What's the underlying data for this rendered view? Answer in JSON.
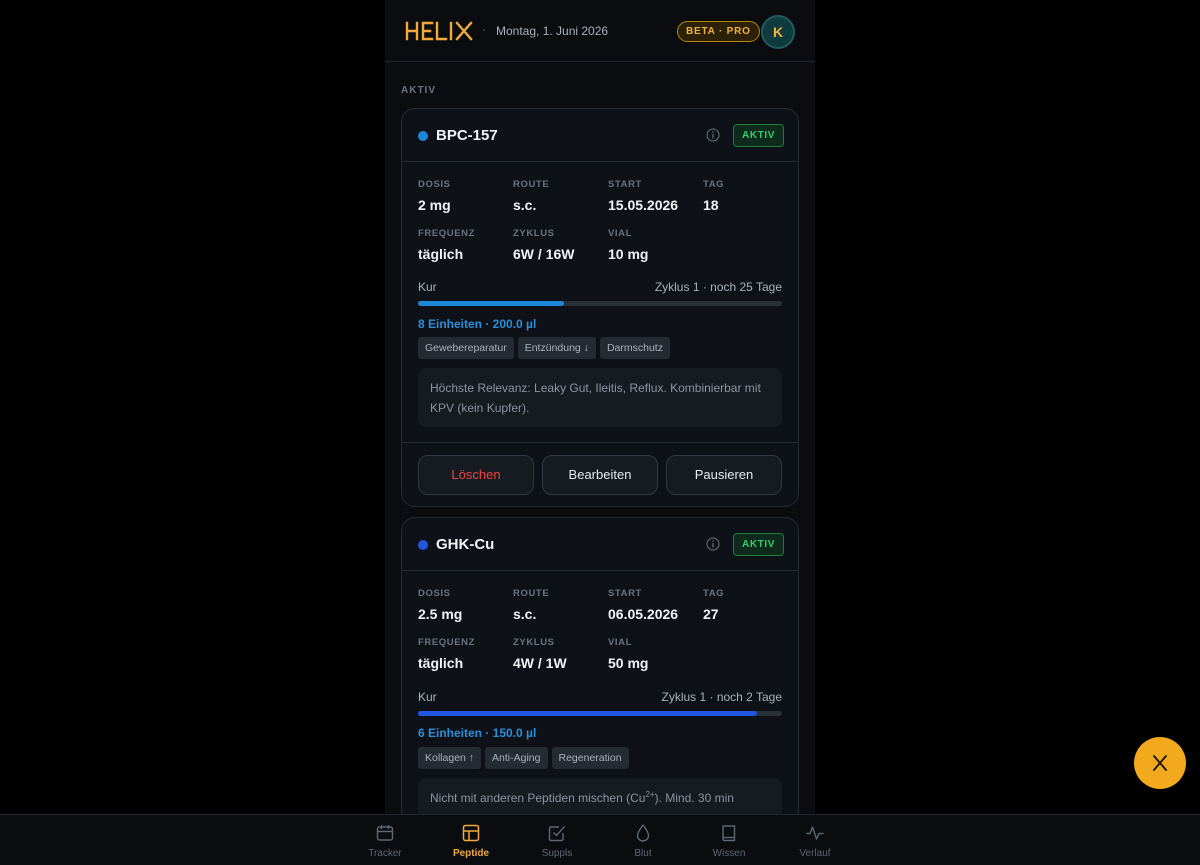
{
  "header": {
    "logo_text": "HELIX",
    "separator": "·",
    "date": "Montag, 1. Juni 2026",
    "badge": "BETA · PRO",
    "avatar_initial": "K"
  },
  "section_label": "AKTIV",
  "field_labels": {
    "dose": "DOSIS",
    "route": "ROUTE",
    "start": "START",
    "day": "TAG",
    "frequency": "FREQUENZ",
    "cycle": "ZYKLUS",
    "vial": "VIAL",
    "course": "Kur"
  },
  "cards": [
    {
      "name": "BPC-157",
      "dot_color": "#1e88d8",
      "status": "AKTIV",
      "dose": "2 mg",
      "route": "s.c.",
      "start": "15.05.2026",
      "day": "18",
      "frequency": "täglich",
      "cycle": "6W / 16W",
      "vial": "10 mg",
      "cycle_info": "Zyklus 1 · noch 25 Tage",
      "progress": 0.4,
      "progress_color": "#1e88d8",
      "units": "8 Einheiten · 200.0 µl",
      "tags": [
        "Gewebereparatur",
        "Entzündung ↓",
        "Darmschutz"
      ],
      "note": "Höchste Relevanz: Leaky Gut, Ileitis, Reflux. Kombinierbar mit KPV (kein Kupfer).",
      "actions": {
        "delete": "Löschen",
        "edit": "Bearbeiten",
        "pause": "Pausieren"
      }
    },
    {
      "name": "GHK-Cu",
      "dot_color": "#2056e0",
      "status": "AKTIV",
      "dose": "2.5 mg",
      "route": "s.c.",
      "start": "06.05.2026",
      "day": "27",
      "frequency": "täglich",
      "cycle": "4W / 1W",
      "vial": "50 mg",
      "cycle_info": "Zyklus 1 · noch 2 Tage",
      "progress": 0.93,
      "progress_color": "#2056e0",
      "units": "6 Einheiten · 150.0 µl",
      "tags": [
        "Kollagen ↑",
        "Anti-Aging",
        "Regeneration"
      ],
      "note_before_sup": "Nicht mit anderen Peptiden mischen (Cu",
      "note_sup": "2+",
      "note_after_sup": "). Mind. 30 min"
    }
  ],
  "nav": [
    {
      "label": "Tracker",
      "icon": "calendar-icon"
    },
    {
      "label": "Peptide",
      "icon": "grid-icon",
      "active": true
    },
    {
      "label": "Suppls",
      "icon": "checkbox-icon"
    },
    {
      "label": "Blut",
      "icon": "drop-icon"
    },
    {
      "label": "Wissen",
      "icon": "book-icon"
    },
    {
      "label": "Verlauf",
      "icon": "pulse-icon"
    }
  ],
  "fab_icon": "helix-x-icon",
  "colors": {
    "accent": "#f2a91c",
    "background": "#0a0c10",
    "card": "#0e1218",
    "status_green": "#2fcf6f",
    "danger": "#ef4444"
  }
}
